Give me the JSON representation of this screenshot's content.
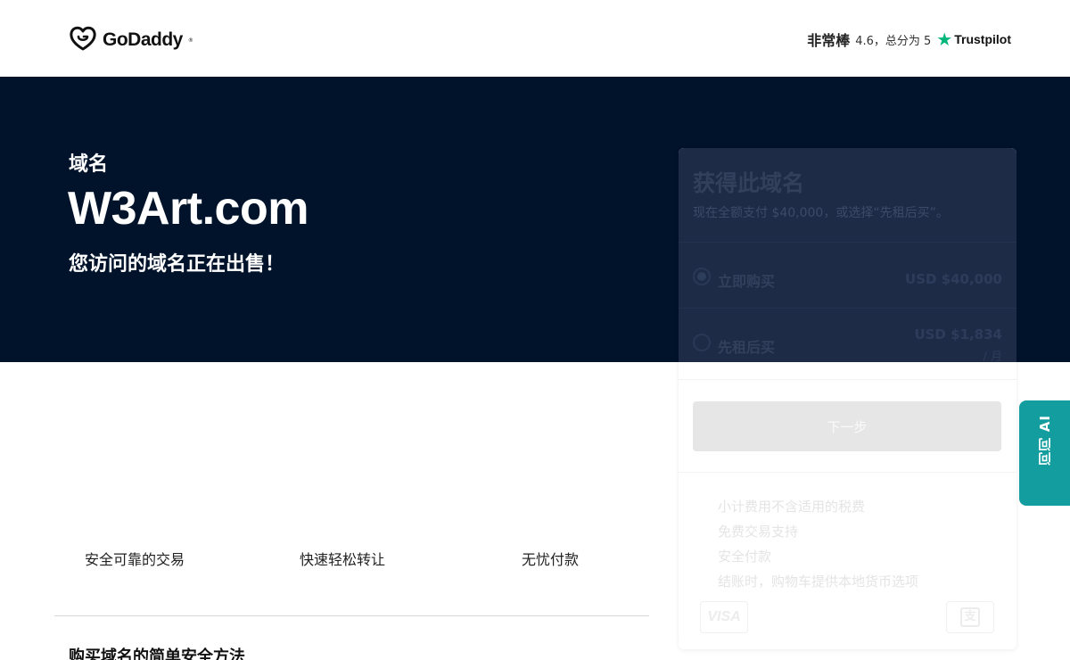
{
  "header": {
    "logo_text": "GoDaddy",
    "logo_tm": "®",
    "logo_icon": "godaddy-heart-logo",
    "rating": {
      "label": "非常棒",
      "score_text": "4.6，总分为 5",
      "star_icon": "star-icon",
      "provider": "Trustpilot",
      "star_color": "#00b67a"
    }
  },
  "hero": {
    "kicker": "域名",
    "domain": "W3Art.com",
    "subtitle": "您访问的域名正在出售！",
    "background": "#00132b"
  },
  "buy_card": {
    "title": "获得此域名",
    "description": "现在全额支付 $40,000，或选择“先租后买”。",
    "options": [
      {
        "label": "立即购买",
        "price": "USD $40,000",
        "selected": true
      },
      {
        "label": "先租后买",
        "price": "USD $1,834",
        "unit": "/ 月",
        "selected": false
      }
    ],
    "next_label": "下一步",
    "features": [
      "小计费用不含适用的税费",
      "免费交易支持",
      "安全付款",
      "结账时，购物车提供本地货币选项"
    ],
    "payment_methods": [
      "VISA",
      "支"
    ]
  },
  "ai_tab": {
    "label": "问问 AI",
    "color": "#139d9e"
  },
  "trust_items": [
    "安全可靠的交易",
    "快速轻松转让",
    "无忧付款"
  ],
  "section": {
    "title": "购买域名的简单安全方法"
  }
}
